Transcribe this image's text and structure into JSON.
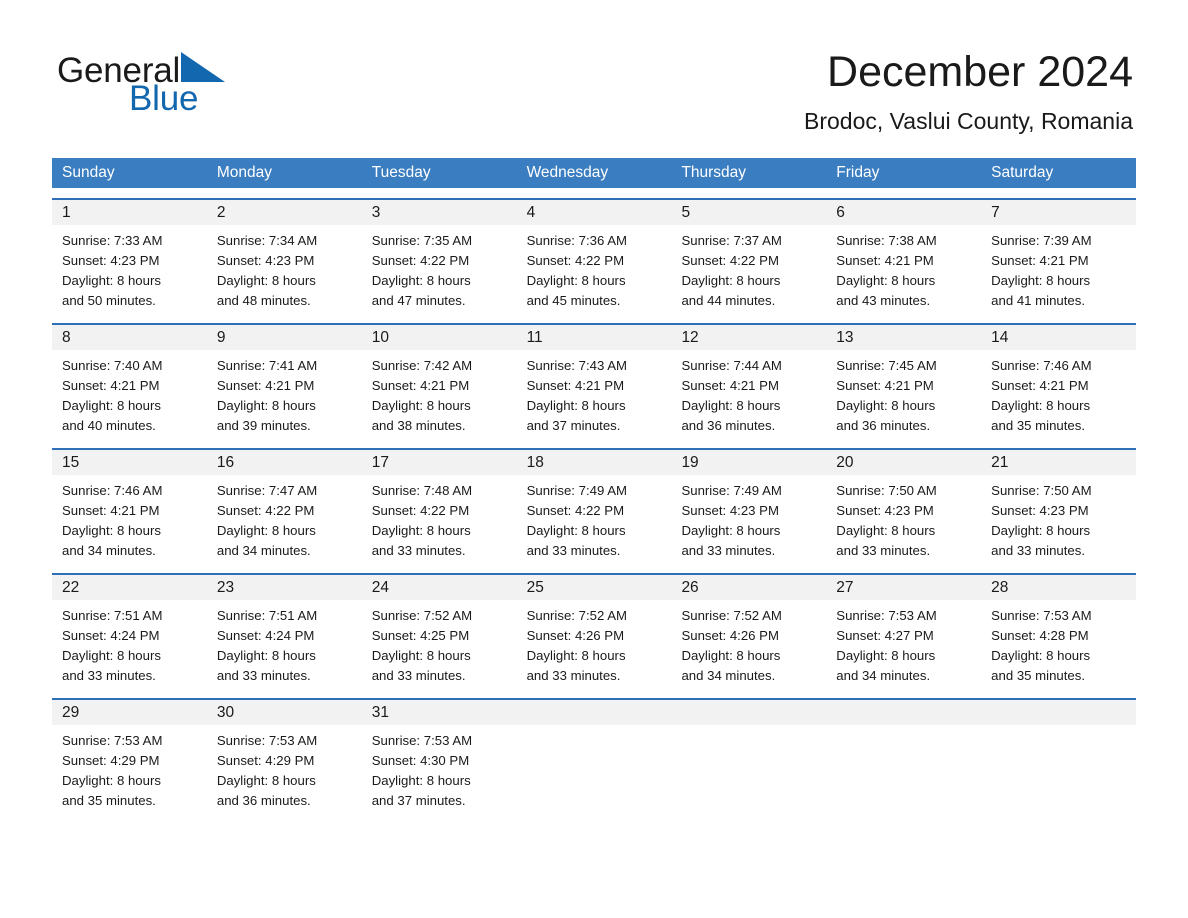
{
  "brand": {
    "name_part1": "General",
    "name_part2": "Blue",
    "logo_icon": "triangle-flag-icon",
    "accent_color": "#1267ae"
  },
  "header": {
    "title": "December 2024",
    "subtitle": "Brodoc, Vaslui County, Romania"
  },
  "calendar": {
    "header_bg": "#3a7dc0",
    "row_divider_color": "#2f6fb5",
    "day_strip_bg": "#f2f2f2",
    "weekdays": [
      "Sunday",
      "Monday",
      "Tuesday",
      "Wednesday",
      "Thursday",
      "Friday",
      "Saturday"
    ],
    "weeks": [
      [
        {
          "day": "1",
          "sunrise": "Sunrise: 7:33 AM",
          "sunset": "Sunset: 4:23 PM",
          "daylight_line1": "Daylight: 8 hours",
          "daylight_line2": "and 50 minutes."
        },
        {
          "day": "2",
          "sunrise": "Sunrise: 7:34 AM",
          "sunset": "Sunset: 4:23 PM",
          "daylight_line1": "Daylight: 8 hours",
          "daylight_line2": "and 48 minutes."
        },
        {
          "day": "3",
          "sunrise": "Sunrise: 7:35 AM",
          "sunset": "Sunset: 4:22 PM",
          "daylight_line1": "Daylight: 8 hours",
          "daylight_line2": "and 47 minutes."
        },
        {
          "day": "4",
          "sunrise": "Sunrise: 7:36 AM",
          "sunset": "Sunset: 4:22 PM",
          "daylight_line1": "Daylight: 8 hours",
          "daylight_line2": "and 45 minutes."
        },
        {
          "day": "5",
          "sunrise": "Sunrise: 7:37 AM",
          "sunset": "Sunset: 4:22 PM",
          "daylight_line1": "Daylight: 8 hours",
          "daylight_line2": "and 44 minutes."
        },
        {
          "day": "6",
          "sunrise": "Sunrise: 7:38 AM",
          "sunset": "Sunset: 4:21 PM",
          "daylight_line1": "Daylight: 8 hours",
          "daylight_line2": "and 43 minutes."
        },
        {
          "day": "7",
          "sunrise": "Sunrise: 7:39 AM",
          "sunset": "Sunset: 4:21 PM",
          "daylight_line1": "Daylight: 8 hours",
          "daylight_line2": "and 41 minutes."
        }
      ],
      [
        {
          "day": "8",
          "sunrise": "Sunrise: 7:40 AM",
          "sunset": "Sunset: 4:21 PM",
          "daylight_line1": "Daylight: 8 hours",
          "daylight_line2": "and 40 minutes."
        },
        {
          "day": "9",
          "sunrise": "Sunrise: 7:41 AM",
          "sunset": "Sunset: 4:21 PM",
          "daylight_line1": "Daylight: 8 hours",
          "daylight_line2": "and 39 minutes."
        },
        {
          "day": "10",
          "sunrise": "Sunrise: 7:42 AM",
          "sunset": "Sunset: 4:21 PM",
          "daylight_line1": "Daylight: 8 hours",
          "daylight_line2": "and 38 minutes."
        },
        {
          "day": "11",
          "sunrise": "Sunrise: 7:43 AM",
          "sunset": "Sunset: 4:21 PM",
          "daylight_line1": "Daylight: 8 hours",
          "daylight_line2": "and 37 minutes."
        },
        {
          "day": "12",
          "sunrise": "Sunrise: 7:44 AM",
          "sunset": "Sunset: 4:21 PM",
          "daylight_line1": "Daylight: 8 hours",
          "daylight_line2": "and 36 minutes."
        },
        {
          "day": "13",
          "sunrise": "Sunrise: 7:45 AM",
          "sunset": "Sunset: 4:21 PM",
          "daylight_line1": "Daylight: 8 hours",
          "daylight_line2": "and 36 minutes."
        },
        {
          "day": "14",
          "sunrise": "Sunrise: 7:46 AM",
          "sunset": "Sunset: 4:21 PM",
          "daylight_line1": "Daylight: 8 hours",
          "daylight_line2": "and 35 minutes."
        }
      ],
      [
        {
          "day": "15",
          "sunrise": "Sunrise: 7:46 AM",
          "sunset": "Sunset: 4:21 PM",
          "daylight_line1": "Daylight: 8 hours",
          "daylight_line2": "and 34 minutes."
        },
        {
          "day": "16",
          "sunrise": "Sunrise: 7:47 AM",
          "sunset": "Sunset: 4:22 PM",
          "daylight_line1": "Daylight: 8 hours",
          "daylight_line2": "and 34 minutes."
        },
        {
          "day": "17",
          "sunrise": "Sunrise: 7:48 AM",
          "sunset": "Sunset: 4:22 PM",
          "daylight_line1": "Daylight: 8 hours",
          "daylight_line2": "and 33 minutes."
        },
        {
          "day": "18",
          "sunrise": "Sunrise: 7:49 AM",
          "sunset": "Sunset: 4:22 PM",
          "daylight_line1": "Daylight: 8 hours",
          "daylight_line2": "and 33 minutes."
        },
        {
          "day": "19",
          "sunrise": "Sunrise: 7:49 AM",
          "sunset": "Sunset: 4:23 PM",
          "daylight_line1": "Daylight: 8 hours",
          "daylight_line2": "and 33 minutes."
        },
        {
          "day": "20",
          "sunrise": "Sunrise: 7:50 AM",
          "sunset": "Sunset: 4:23 PM",
          "daylight_line1": "Daylight: 8 hours",
          "daylight_line2": "and 33 minutes."
        },
        {
          "day": "21",
          "sunrise": "Sunrise: 7:50 AM",
          "sunset": "Sunset: 4:23 PM",
          "daylight_line1": "Daylight: 8 hours",
          "daylight_line2": "and 33 minutes."
        }
      ],
      [
        {
          "day": "22",
          "sunrise": "Sunrise: 7:51 AM",
          "sunset": "Sunset: 4:24 PM",
          "daylight_line1": "Daylight: 8 hours",
          "daylight_line2": "and 33 minutes."
        },
        {
          "day": "23",
          "sunrise": "Sunrise: 7:51 AM",
          "sunset": "Sunset: 4:24 PM",
          "daylight_line1": "Daylight: 8 hours",
          "daylight_line2": "and 33 minutes."
        },
        {
          "day": "24",
          "sunrise": "Sunrise: 7:52 AM",
          "sunset": "Sunset: 4:25 PM",
          "daylight_line1": "Daylight: 8 hours",
          "daylight_line2": "and 33 minutes."
        },
        {
          "day": "25",
          "sunrise": "Sunrise: 7:52 AM",
          "sunset": "Sunset: 4:26 PM",
          "daylight_line1": "Daylight: 8 hours",
          "daylight_line2": "and 33 minutes."
        },
        {
          "day": "26",
          "sunrise": "Sunrise: 7:52 AM",
          "sunset": "Sunset: 4:26 PM",
          "daylight_line1": "Daylight: 8 hours",
          "daylight_line2": "and 34 minutes."
        },
        {
          "day": "27",
          "sunrise": "Sunrise: 7:53 AM",
          "sunset": "Sunset: 4:27 PM",
          "daylight_line1": "Daylight: 8 hours",
          "daylight_line2": "and 34 minutes."
        },
        {
          "day": "28",
          "sunrise": "Sunrise: 7:53 AM",
          "sunset": "Sunset: 4:28 PM",
          "daylight_line1": "Daylight: 8 hours",
          "daylight_line2": "and 35 minutes."
        }
      ],
      [
        {
          "day": "29",
          "sunrise": "Sunrise: 7:53 AM",
          "sunset": "Sunset: 4:29 PM",
          "daylight_line1": "Daylight: 8 hours",
          "daylight_line2": "and 35 minutes."
        },
        {
          "day": "30",
          "sunrise": "Sunrise: 7:53 AM",
          "sunset": "Sunset: 4:29 PM",
          "daylight_line1": "Daylight: 8 hours",
          "daylight_line2": "and 36 minutes."
        },
        {
          "day": "31",
          "sunrise": "Sunrise: 7:53 AM",
          "sunset": "Sunset: 4:30 PM",
          "daylight_line1": "Daylight: 8 hours",
          "daylight_line2": "and 37 minutes."
        },
        {
          "day": "",
          "sunrise": "",
          "sunset": "",
          "daylight_line1": "",
          "daylight_line2": ""
        },
        {
          "day": "",
          "sunrise": "",
          "sunset": "",
          "daylight_line1": "",
          "daylight_line2": ""
        },
        {
          "day": "",
          "sunrise": "",
          "sunset": "",
          "daylight_line1": "",
          "daylight_line2": ""
        },
        {
          "day": "",
          "sunrise": "",
          "sunset": "",
          "daylight_line1": "",
          "daylight_line2": ""
        }
      ]
    ]
  }
}
